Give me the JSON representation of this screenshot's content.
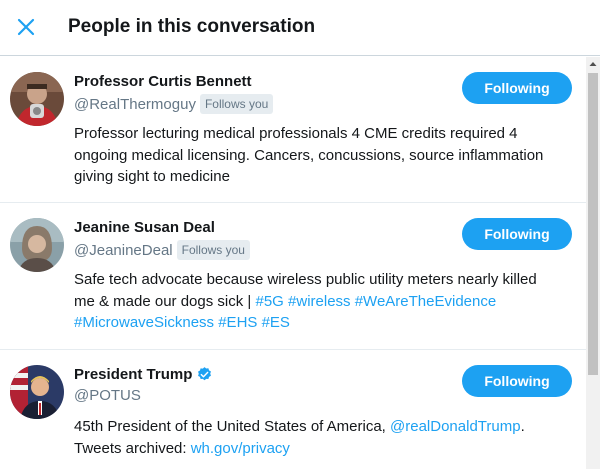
{
  "header": {
    "title": "People in this conversation",
    "close_icon": "close-icon"
  },
  "colors": {
    "accent": "#1da1f2",
    "text": "#14171a",
    "muted": "#657786",
    "badge_bg": "#e6ecf0"
  },
  "people": [
    {
      "name": "Professor Curtis Bennett",
      "handle": "@RealThermoguy",
      "follows_you": "Follows you",
      "button": "Following",
      "bio_lines": [
        "Professor lecturing medical professionals 4 CME credits required 4",
        "ongoing medical licensing. Cancers, concussions, source inflammation",
        "giving sight to medicine"
      ]
    },
    {
      "name": "Jeanine Susan Deal",
      "handle": "@JeanineDeal",
      "follows_you": "Follows you",
      "button": "Following",
      "bio_line1": "Safe tech advocate because wireless public utility meters nearly killed",
      "bio_line2_text": "me & made our dogs sick | ",
      "bio_line2_tags": [
        "#5G",
        "#wireless",
        "#WeAreTheEvidence"
      ],
      "bio_line3_tags": [
        "#MicrowaveSickness",
        "#EHS",
        "#ES"
      ]
    },
    {
      "name": "President Trump",
      "handle": "@POTUS",
      "verified_icon": "verified-badge-icon",
      "button": "Following",
      "bio_line1_text": "45th President of the United States of America, ",
      "bio_line1_link": "@realDonaldTrump",
      "bio_line1_end": ".",
      "bio_line2_text": "Tweets archived: ",
      "bio_line2_link": "wh.gov/privacy"
    }
  ]
}
